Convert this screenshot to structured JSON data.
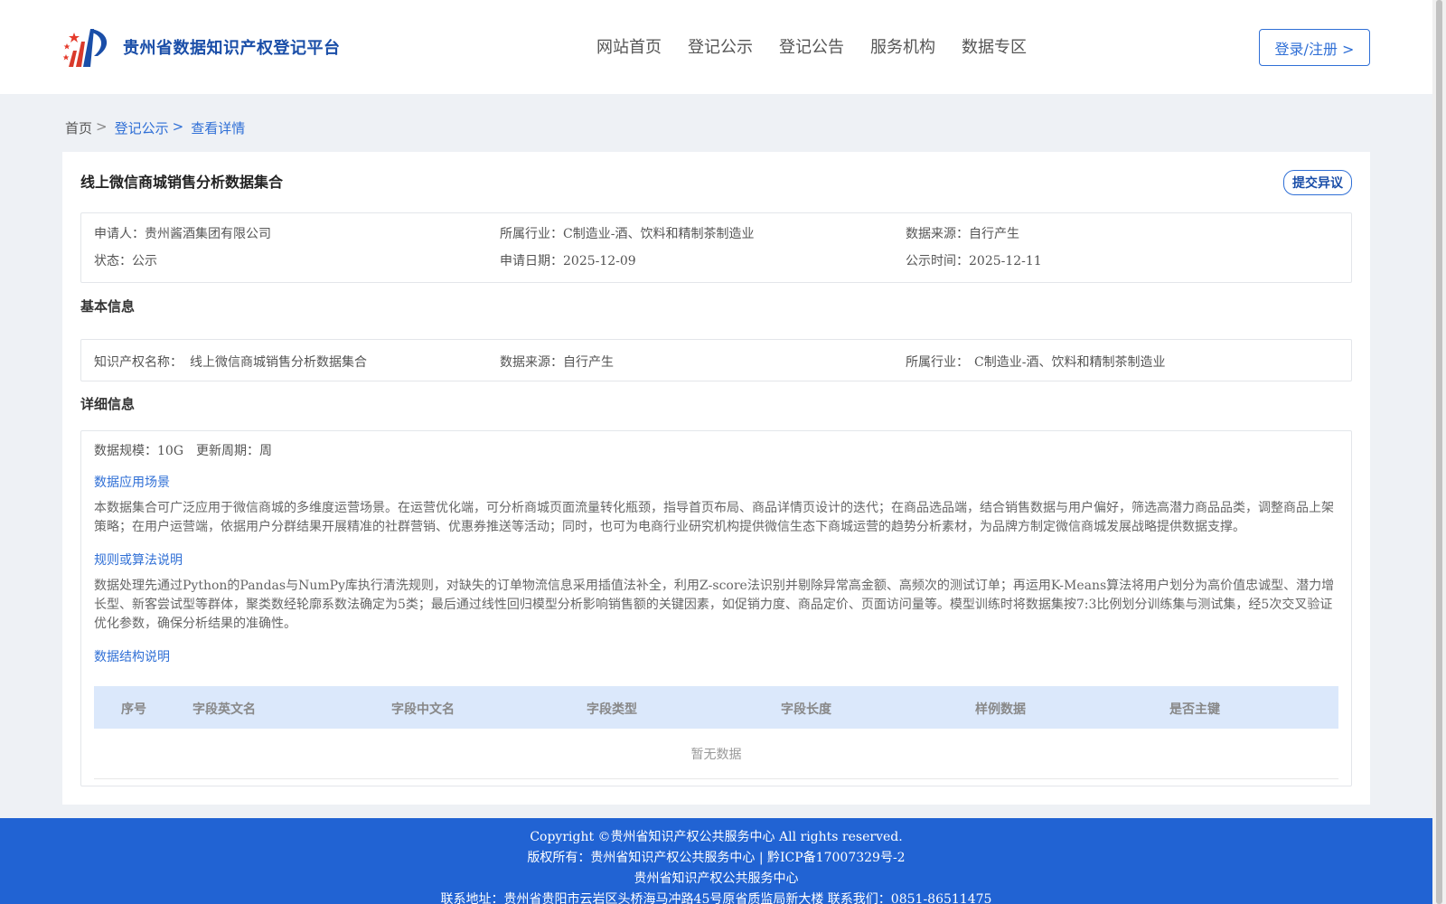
{
  "header": {
    "site_title": "贵州省数据知识产权登记平台",
    "nav": [
      "网站首页",
      "登记公示",
      "登记公告",
      "服务机构",
      "数据专区"
    ],
    "login_label": "登录/注册 >"
  },
  "breadcrumb": {
    "home": "首页",
    "sep": ">",
    "items": [
      "登记公示",
      "查看详情"
    ]
  },
  "record": {
    "title": "线上微信商城销售分析数据集合",
    "objection_label": "提交异议",
    "summary": {
      "applicant_key": "申请人：",
      "applicant_value": "贵州酱酒集团有限公司",
      "industry_key": "所属行业：",
      "industry_value": "C制造业-酒、饮料和精制茶制造业",
      "source_key": "数据来源：",
      "source_value": "自行产生",
      "status_key": "状态：",
      "status_value": "公示",
      "apply_date_key": "申请日期：",
      "apply_date_value": "2025-12-09",
      "publish_time_key": "公示时间：",
      "publish_time_value": "2025-12-11"
    },
    "basic": {
      "label": "基本信息",
      "ip_name_key": "知识产权名称：",
      "ip_name_value": "线上微信商城销售分析数据集合",
      "source_key": "数据来源：",
      "source_value": "自行产生",
      "industry_key": "所属行业：",
      "industry_value": "C制造业-酒、饮料和精制茶制造业"
    },
    "detail": {
      "label": "详细信息",
      "scale_key": "数据规模：",
      "scale_value": "10G",
      "cycle_key": "更新周期：",
      "cycle_value": "周",
      "scenario_head": "数据应用场景",
      "scenario_text": "本数据集合可广泛应用于微信商城的多维度运营场景。在运营优化端，可分析商城页面流量转化瓶颈，指导首页布局、商品详情页设计的迭代；在商品选品端，结合销售数据与用户偏好，筛选高潜力商品品类，调整商品上架策略；在用户运营端，依据用户分群结果开展精准的社群营销、优惠券推送等活动；同时，也可为电商行业研究机构提供微信生态下商城运营的趋势分析素材，为品牌方制定微信商城发展战略提供数据支撑。",
      "algorithm_head": "规则或算法说明",
      "algorithm_text": "数据处理先通过Python的Pandas与NumPy库执行清洗规则，对缺失的订单物流信息采用插值法补全，利用Z-score法识别并剔除异常高金额、高频次的测试订单；再运用K-Means算法将用户划分为高价值忠诚型、潜力增长型、新客尝试型等群体，聚类数经轮廓系数法确定为5类；最后通过线性回归模型分析影响销售额的关键因素，如促销力度、商品定价、页面访问量等。模型训练时将数据集按7:3比例划分训练集与测试集，经5次交叉验证优化参数，确保分析结果的准确性。",
      "structure_head": "数据结构说明",
      "table_columns": [
        "序号",
        "字段英文名",
        "字段中文名",
        "字段类型",
        "字段长度",
        "样例数据",
        "是否主键"
      ],
      "empty_text": "暂无数据"
    }
  },
  "footer": {
    "copyright": "Copyright ©贵州省知识产权公共服务中心 All rights reserved.",
    "owner": "版权所有：贵州省知识产权公共服务中心 | 黔ICP备17007329号-2",
    "org": "贵州省知识产权公共服务中心",
    "contact": "联系地址：贵州省贵阳市云岩区头桥海马冲路45号原省质监局新大楼 联系我们：0851-86511475"
  },
  "colors": {
    "brand_blue": "#2f6fd6",
    "footer_blue": "#2163d3",
    "table_head_bg": "#dbe8fb"
  }
}
